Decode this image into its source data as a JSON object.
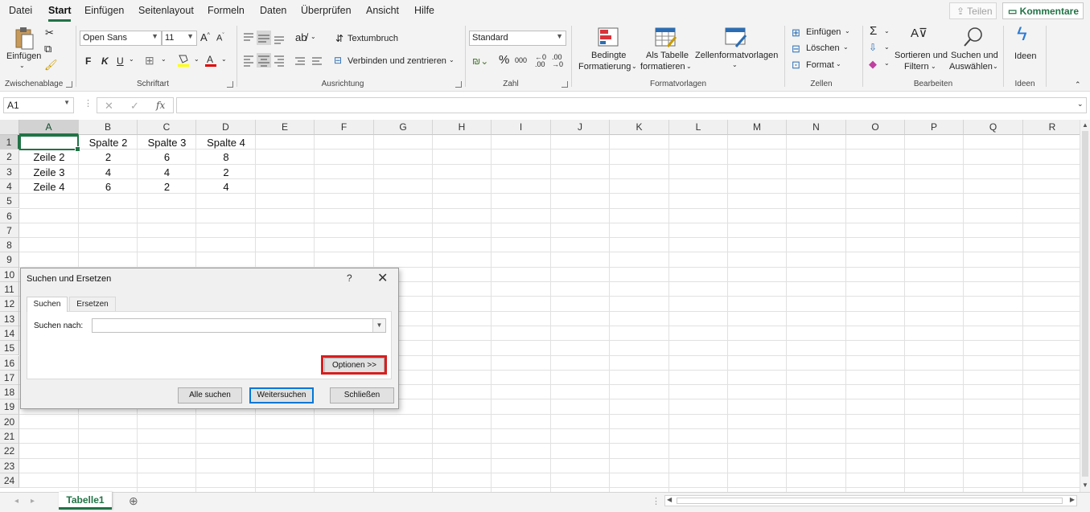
{
  "menu": {
    "items": [
      "Datei",
      "Start",
      "Einfügen",
      "Seitenlayout",
      "Formeln",
      "Daten",
      "Überprüfen",
      "Ansicht",
      "Hilfe"
    ],
    "share": "Teilen",
    "comments": "Kommentare"
  },
  "ribbon": {
    "clipboard": {
      "paste": "Einfügen",
      "group": "Zwischenablage"
    },
    "font": {
      "name": "Open Sans",
      "size": "11",
      "bold": "F",
      "italic": "K",
      "underline": "U",
      "grow": "A^",
      "shrink": "Aˇ",
      "group": "Schriftart"
    },
    "alignment": {
      "wrap": "Textumbruch",
      "merge": "Verbinden und zentrieren",
      "group": "Ausrichtung"
    },
    "number": {
      "format": "Standard",
      "group": "Zahl"
    },
    "styles": {
      "conditional_1": "Bedingte",
      "conditional_2": "Formatierung",
      "table_1": "Als Tabelle",
      "table_2": "formatieren",
      "cellstyles": "Zellenformatvorlagen",
      "group": "Formatvorlagen"
    },
    "cells": {
      "insert": "Einfügen",
      "delete": "Löschen",
      "format": "Format",
      "group": "Zellen"
    },
    "editing": {
      "sort_1": "Sortieren und",
      "sort_2": "Filtern",
      "find_1": "Suchen und",
      "find_2": "Auswählen",
      "group": "Bearbeiten"
    },
    "ideas": {
      "label": "Ideen",
      "group": "Ideen"
    }
  },
  "formula_bar": {
    "name_box": "A1",
    "fx": "fx",
    "value": ""
  },
  "sheet": {
    "columns": [
      "A",
      "B",
      "C",
      "D",
      "E",
      "F",
      "G",
      "H",
      "I",
      "J",
      "K",
      "L",
      "M",
      "N",
      "O",
      "P",
      "Q",
      "R"
    ],
    "rows": [
      "1",
      "2",
      "3",
      "4",
      "5",
      "6",
      "7",
      "8",
      "9",
      "10",
      "11",
      "12",
      "13",
      "14",
      "15",
      "16",
      "17",
      "18",
      "19",
      "20",
      "21",
      "22",
      "23",
      "24"
    ],
    "cells": {
      "B1": "Spalte 2",
      "C1": "Spalte 3",
      "D1": "Spalte 4",
      "A2": "Zeile 2",
      "B2": "2",
      "C2": "6",
      "D2": "8",
      "A3": "Zeile 3",
      "B3": "4",
      "C3": "4",
      "D3": "2",
      "A4": "Zeile 4",
      "B4": "6",
      "C4": "2",
      "D4": "4"
    },
    "tab": "Tabelle1"
  },
  "dialog": {
    "title": "Suchen und Ersetzen",
    "help": "?",
    "close": "✕",
    "tab_find": "Suchen",
    "tab_replace": "Ersetzen",
    "find_label": "Suchen nach:",
    "find_value": "",
    "options": "Optionen >>",
    "find_all": "Alle suchen",
    "find_next": "Weitersuchen",
    "close_btn": "Schließen"
  },
  "colors": {
    "accent": "#217346",
    "highlight": "#d81e1e"
  }
}
